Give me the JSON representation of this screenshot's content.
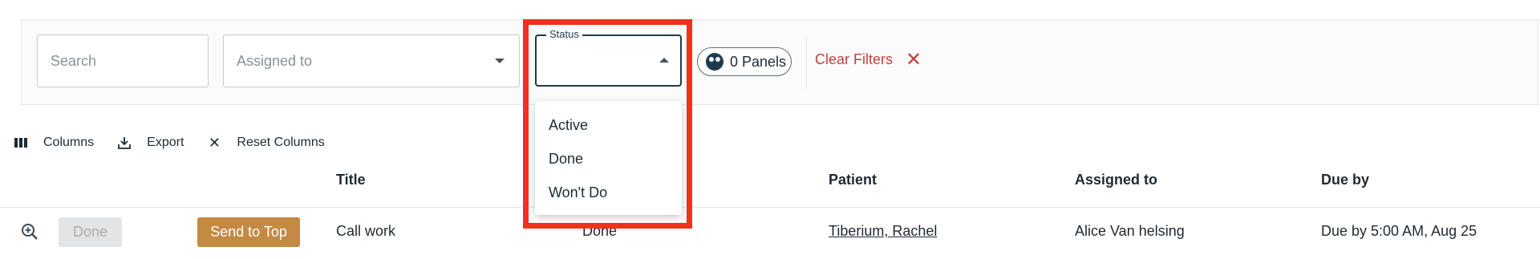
{
  "filters": {
    "search": {
      "placeholder": "Search"
    },
    "assigned_to": {
      "placeholder": "Assigned to"
    },
    "status": {
      "label": "Status",
      "value": "",
      "options": [
        "Active",
        "Done",
        "Won't Do"
      ]
    },
    "panels_label": "0 Panels",
    "clear_filters_label": "Clear Filters"
  },
  "toolbar": {
    "columns_label": "Columns",
    "export_label": "Export",
    "reset_columns_label": "Reset Columns"
  },
  "table": {
    "columns": [
      "Title",
      "Patient",
      "Assigned to",
      "Due by"
    ],
    "rows": [
      {
        "done_label": "Done",
        "send_to_top_label": "Send to Top",
        "title": "Call work",
        "status": "Done",
        "patient": "Tiberium, Rachel",
        "assigned_to": "Alice Van helsing",
        "due_by": "Due by 5:00 AM, Aug 25"
      }
    ]
  },
  "colors": {
    "accent_red": "#c0433d",
    "highlight": "#f2301b",
    "send_to_top": "#c38a44",
    "field_border_active": "#1f3a4d"
  },
  "icons": [
    "chevron-down-icon",
    "chevron-up-icon",
    "panels-icon",
    "close-icon",
    "columns-icon",
    "download-icon",
    "zoom-in-icon"
  ]
}
